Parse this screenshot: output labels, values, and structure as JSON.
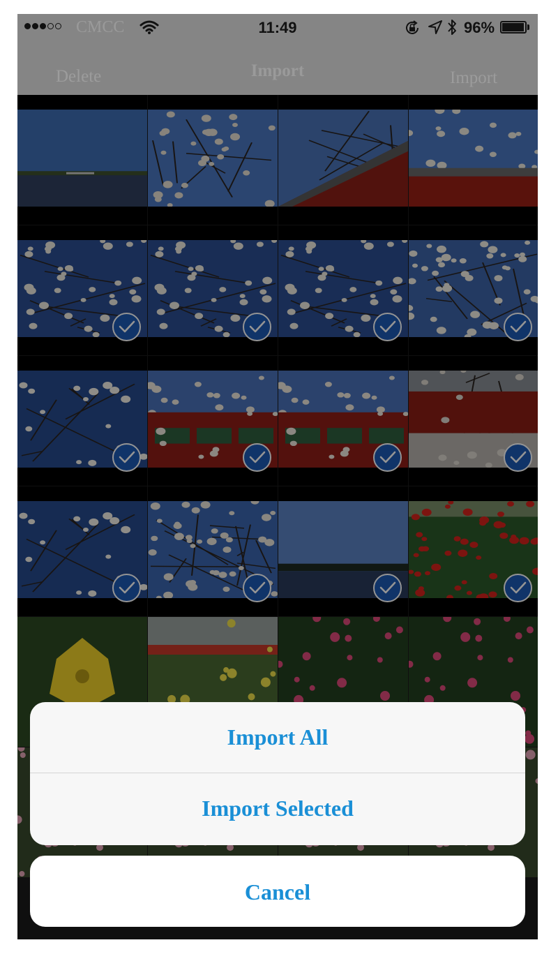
{
  "status_bar": {
    "carrier": "CMCC",
    "time": "11:49",
    "battery_percent": "96%",
    "battery_level": 0.96,
    "signal_dots": [
      true,
      true,
      true,
      false,
      false
    ],
    "icons": [
      "signal-dots-icon",
      "wifi-icon",
      "rotation-lock-icon",
      "location-arrow-icon",
      "bluetooth-icon",
      "battery-icon"
    ]
  },
  "nav_bar": {
    "left_label": "Delete",
    "title": "Import",
    "right_label": "Import"
  },
  "photos": [
    {
      "scene": "lake-horizon",
      "selected": false
    },
    {
      "scene": "magnolia-branches-sky",
      "selected": false
    },
    {
      "scene": "red-temple-roof",
      "selected": false
    },
    {
      "scene": "blossoms-over-roof",
      "selected": false
    },
    {
      "scene": "magnolia-blossoms",
      "selected": true
    },
    {
      "scene": "magnolia-blossoms",
      "selected": true
    },
    {
      "scene": "magnolia-blossoms",
      "selected": true
    },
    {
      "scene": "magnolia-blossoms-light",
      "selected": true
    },
    {
      "scene": "magnolia-closeup",
      "selected": true
    },
    {
      "scene": "blossoms-red-building",
      "selected": true
    },
    {
      "scene": "blossoms-red-building",
      "selected": true
    },
    {
      "scene": "red-pavilion-tree",
      "selected": true
    },
    {
      "scene": "magnolia-closeup",
      "selected": true
    },
    {
      "scene": "magnolia-tree-branches",
      "selected": true
    },
    {
      "scene": "lake-sky",
      "selected": true
    },
    {
      "scene": "red-tulip-field",
      "selected": true
    },
    {
      "scene": "yellow-flower",
      "selected": false
    },
    {
      "scene": "tulip-garden",
      "selected": false
    },
    {
      "scene": "pink-flowers",
      "selected": false
    },
    {
      "scene": "pink-flowers",
      "selected": false
    },
    {
      "scene": "garden-flowers",
      "selected": false
    },
    {
      "scene": "garden-flowers",
      "selected": false
    },
    {
      "scene": "garden-flowers",
      "selected": false
    },
    {
      "scene": "garden-flowers",
      "selected": false
    }
  ],
  "action_sheet": {
    "import_all": "Import All",
    "import_selected": "Import Selected",
    "cancel": "Cancel"
  },
  "colors": {
    "accent": "#1a8fd6",
    "check_badge": "#1d5ab5",
    "bar_background": "#858585",
    "sheet_background": "#f7f7f7"
  }
}
